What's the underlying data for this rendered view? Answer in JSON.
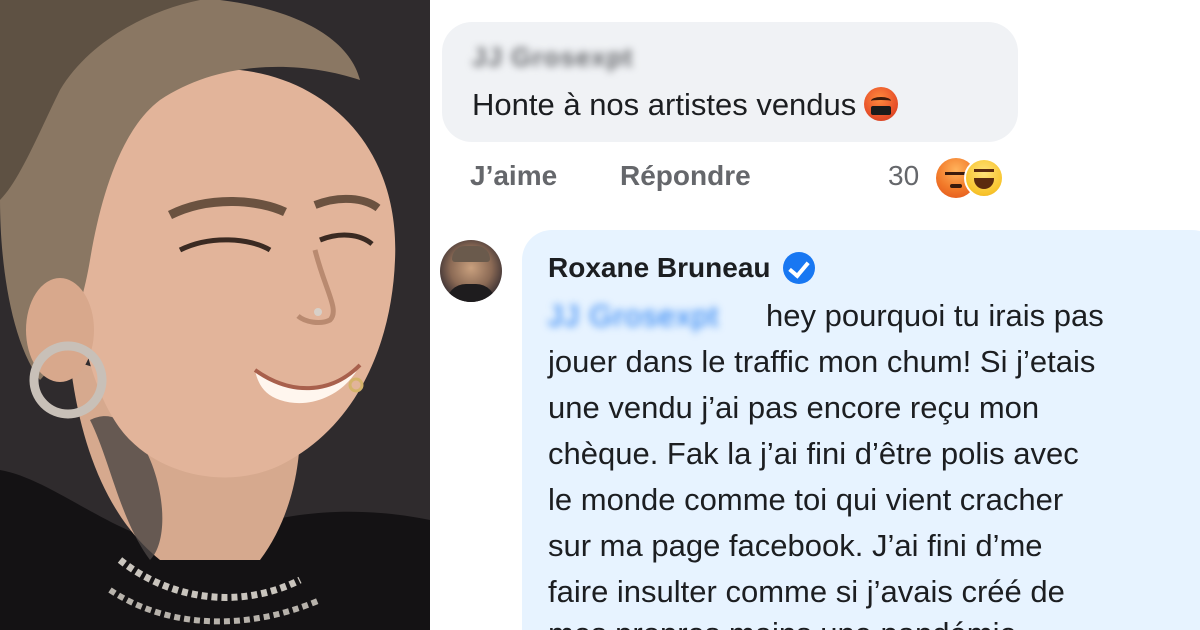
{
  "comment_1": {
    "author_blurred": "JJ Grosexpt",
    "text": "Honte à nos artistes vendus",
    "emoji": "cursing-face-emoji",
    "actions": {
      "like_label": "J’aime",
      "reply_label": "Répondre"
    },
    "reaction_count": "30",
    "reactions": [
      "angry-reaction-icon",
      "haha-reaction-icon"
    ]
  },
  "reply": {
    "author_name": "Roxane Bruneau",
    "verified": true,
    "mention_blurred": "JJ Grosexpt",
    "lines": [
      "hey pourquoi tu irais pas",
      "jouer dans le traffic mon chum! Si j’etais",
      "une vendu j’ai pas encore reçu mon",
      "chèque. Fak la j’ai fini d’être polis avec",
      "le monde comme toi qui vient cracher",
      "sur ma page facebook. J’ai fini d’me",
      "faire insulter comme si j’avais créé de",
      "mes propres mains une pandémie"
    ]
  },
  "colors": {
    "comment_bubble": "#f0f2f5",
    "reply_bubble": "#e7f3ff",
    "verified_blue": "#1877f2",
    "meta_gray": "#65676b"
  }
}
